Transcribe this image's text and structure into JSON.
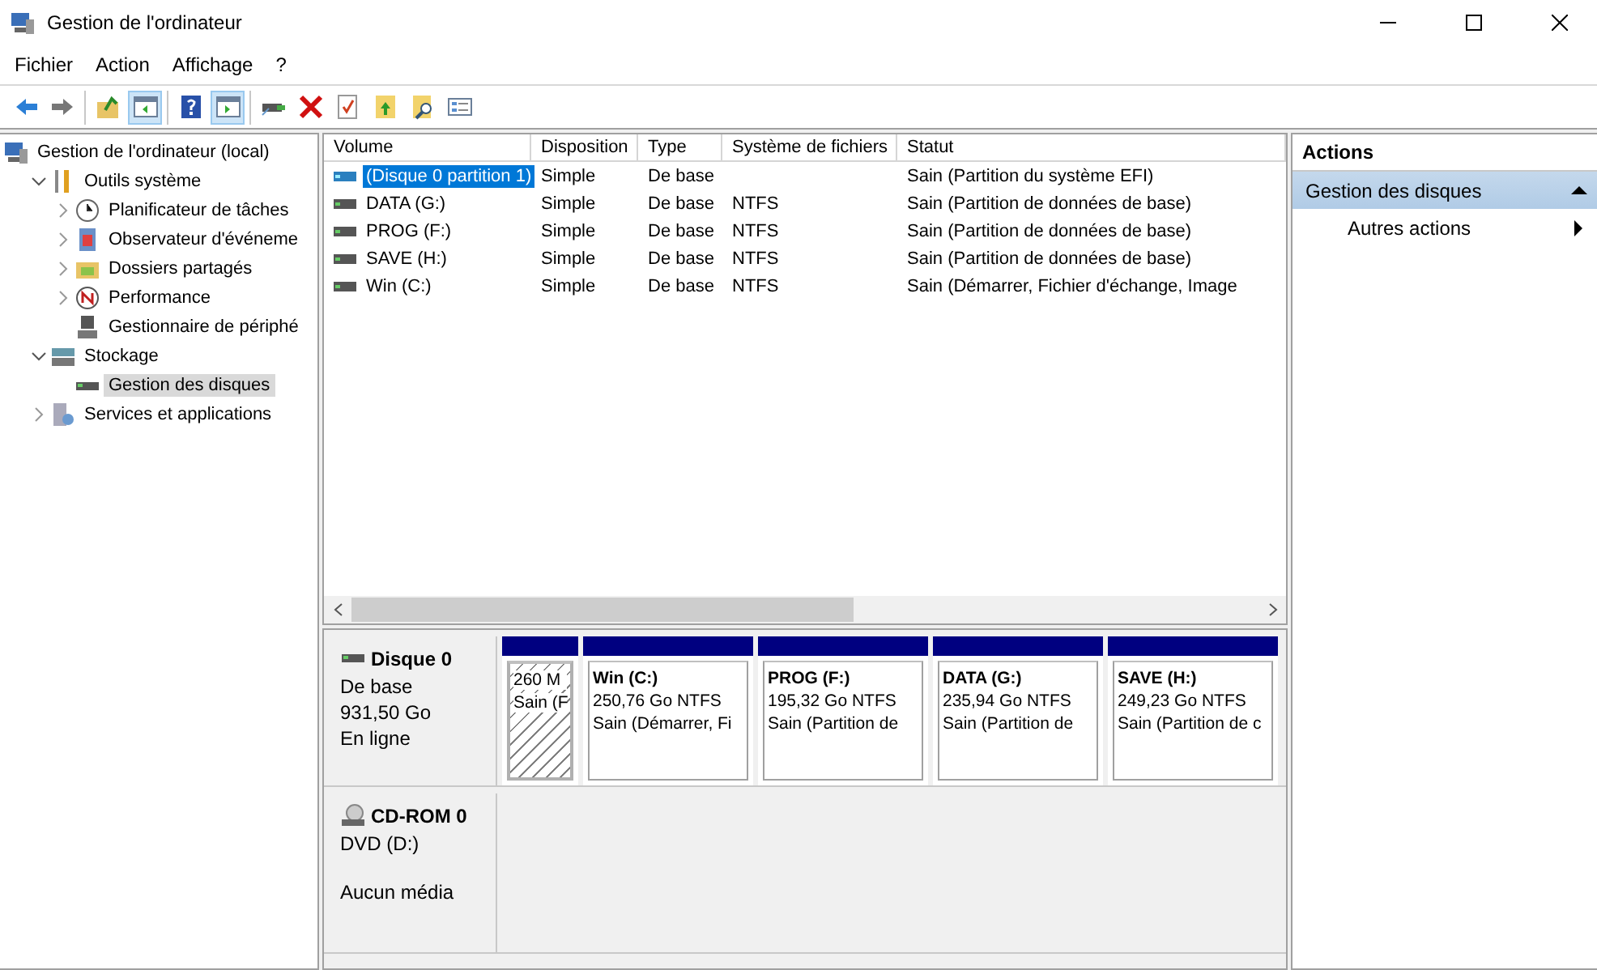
{
  "window": {
    "title": "Gestion de l'ordinateur"
  },
  "menu": [
    "Fichier",
    "Action",
    "Affichage",
    "?"
  ],
  "toolbar": [
    [
      {
        "pressed": false
      },
      {
        "pressed": false
      }
    ],
    [
      {
        "pressed": false
      },
      {
        "pressed": true
      }
    ],
    [
      {
        "pressed": false
      },
      {
        "pressed": true
      }
    ],
    [
      {
        "pressed": false
      },
      {
        "pressed": false
      },
      {
        "pressed": false
      },
      {
        "pressed": false
      },
      {
        "pressed": false
      },
      {
        "pressed": false
      }
    ]
  ],
  "tree": [
    {
      "label": "Gestion de l'ordinateur (local)",
      "selected": false,
      "children": [
        {
          "label": "Outils système",
          "selected": false,
          "expanded": true,
          "children": [
            {
              "label": "Planificateur de tâches",
              "selected": false,
              "expanded": false
            },
            {
              "label": "Observateur d'événeme",
              "selected": false,
              "expanded": false
            },
            {
              "label": "Dossiers partagés",
              "selected": false,
              "expanded": false
            },
            {
              "label": "Performance",
              "selected": false,
              "expanded": false
            },
            {
              "label": "Gestionnaire de périphé",
              "selected": false
            }
          ]
        },
        {
          "label": "Stockage",
          "selected": false,
          "expanded": true,
          "children": [
            {
              "label": "Gestion des disques",
              "selected": true
            }
          ]
        },
        {
          "label": "Services et applications",
          "selected": false,
          "expanded": false
        }
      ]
    }
  ],
  "table": {
    "columns": [
      "Volume",
      "Disposition",
      "Type",
      "Système de fichiers",
      "Statut"
    ],
    "rows": [
      {
        "cells": [
          "(Disque 0 partition 1)",
          "Simple",
          "De base",
          "",
          "Sain (Partition du système EFI)"
        ],
        "selected": true
      },
      {
        "cells": [
          "DATA (G:)",
          "Simple",
          "De base",
          "NTFS",
          "Sain (Partition de données de base)"
        ],
        "selected": false
      },
      {
        "cells": [
          "PROG (F:)",
          "Simple",
          "De base",
          "NTFS",
          "Sain (Partition de données de base)"
        ],
        "selected": false
      },
      {
        "cells": [
          "SAVE (H:)",
          "Simple",
          "De base",
          "NTFS",
          "Sain (Partition de données de base)"
        ],
        "selected": false
      },
      {
        "cells": [
          "Win (C:)",
          "Simple",
          "De base",
          "NTFS",
          "Sain (Démarrer, Fichier d'échange, Image"
        ],
        "selected": false
      }
    ]
  },
  "disks": [
    {
      "kind": "disk",
      "name": "Disque 0",
      "lines": [
        "De base",
        "931,50 Go",
        "En ligne"
      ],
      "partitions": [
        {
          "kind": "hatched",
          "size": "260 M",
          "status": "Sain (F"
        },
        {
          "kind": "normal",
          "name": "Win  (C:)",
          "size": "250,76 Go NTFS",
          "status": "Sain (Démarrer, Fi"
        },
        {
          "kind": "normal",
          "name": "PROG  (F:)",
          "size": "195,32 Go NTFS",
          "status": "Sain (Partition de"
        },
        {
          "kind": "normal",
          "name": "DATA  (G:)",
          "size": "235,94 Go NTFS",
          "status": "Sain (Partition de"
        },
        {
          "kind": "normal",
          "name": "SAVE  (H:)",
          "size": "249,23 Go NTFS",
          "status": "Sain (Partition de c"
        }
      ]
    },
    {
      "kind": "cdrom",
      "name": "CD-ROM 0",
      "lines": [
        "DVD (D:)"
      ],
      "note": "Aucun média"
    }
  ],
  "actions": {
    "title": "Actions",
    "section": {
      "label": "Gestion des disques",
      "expanded": true
    },
    "items": [
      "Autres actions"
    ]
  }
}
